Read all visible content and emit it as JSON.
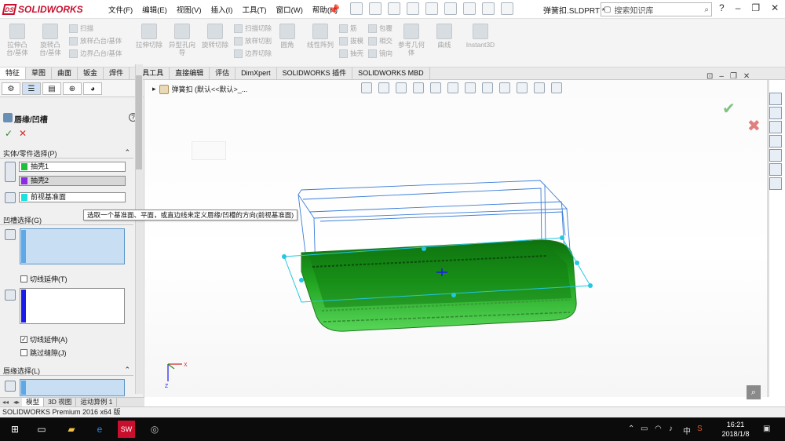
{
  "app": {
    "logo_text": "SOLIDWORKS",
    "menu": [
      "文件(F)",
      "编辑(E)",
      "视图(V)",
      "插入(I)",
      "工具(T)",
      "窗口(W)",
      "帮助(H)"
    ],
    "filename": "弹簧扣.SLDPRT *",
    "search_placeholder": "搜索知识库"
  },
  "ribbon": {
    "features": {
      "extrude_boss": "拉伸凸台/基体",
      "revolve_boss": "旋转凸台/基体",
      "sweep": "扫描",
      "loft": "放样凸台/基体",
      "boundary": "边界凸台/基体",
      "extrude_cut": "拉伸切除",
      "hole_wizard": "异型孔向导",
      "revolve_cut": "旋转切除",
      "swept_cut": "扫描切除",
      "lofted_cut": "放样切割",
      "boundary_cut": "边界切除",
      "fillet": "圆角",
      "linear_pattern": "线性阵列",
      "rib": "筋",
      "draft": "拔模",
      "shell": "抽壳",
      "wrap": "包覆",
      "intersect": "相交",
      "mirror": "镜向",
      "ref_geometry": "参考几何体",
      "curves": "曲线",
      "instant3d": "Instant3D"
    }
  },
  "tabs": [
    "特征",
    "草图",
    "曲面",
    "钣金",
    "焊件",
    "模具工具",
    "直接编辑",
    "评估",
    "DimXpert",
    "SOLIDWORKS 插件",
    "SOLIDWORKS MBD"
  ],
  "panel": {
    "feature_title": "唇缘/凹槽",
    "help_glyph": "?",
    "ok_glyph": "✓",
    "cancel_glyph": "✕",
    "sec_body": "实体/零件选择(P)",
    "body_items": [
      "抽壳1",
      "抽壳2"
    ],
    "plane_item": "前视基准面",
    "sec_groove": "凹槽选择(G)",
    "tangent_1": "切线延伸(T)",
    "tangent_2": "切线延伸(A)",
    "jump_gaps": "跳过缝隙(J)",
    "sec_lip": "唇缘选择(L)",
    "chevron": "⌃"
  },
  "bottom_tabs": [
    "模型",
    "3D 视图",
    "运动算例 1"
  ],
  "viewport": {
    "doc_title": "弹簧扣 (默认<<默认>_...",
    "tooltip": "选取一个基准面、平面，或直边线来定义唇缘/凹槽的方向(前视基准面)"
  },
  "statusbar": "SOLIDWORKS Premium 2016 x64 版",
  "taskbar": {
    "time": "16:21",
    "date": "2018/1/8",
    "ime": "中"
  },
  "colors": {
    "accent": "#c8102e",
    "green_body": "#1fa41f",
    "blue_wire": "#3b7dd8",
    "cyan_plane": "#22c7e0"
  }
}
